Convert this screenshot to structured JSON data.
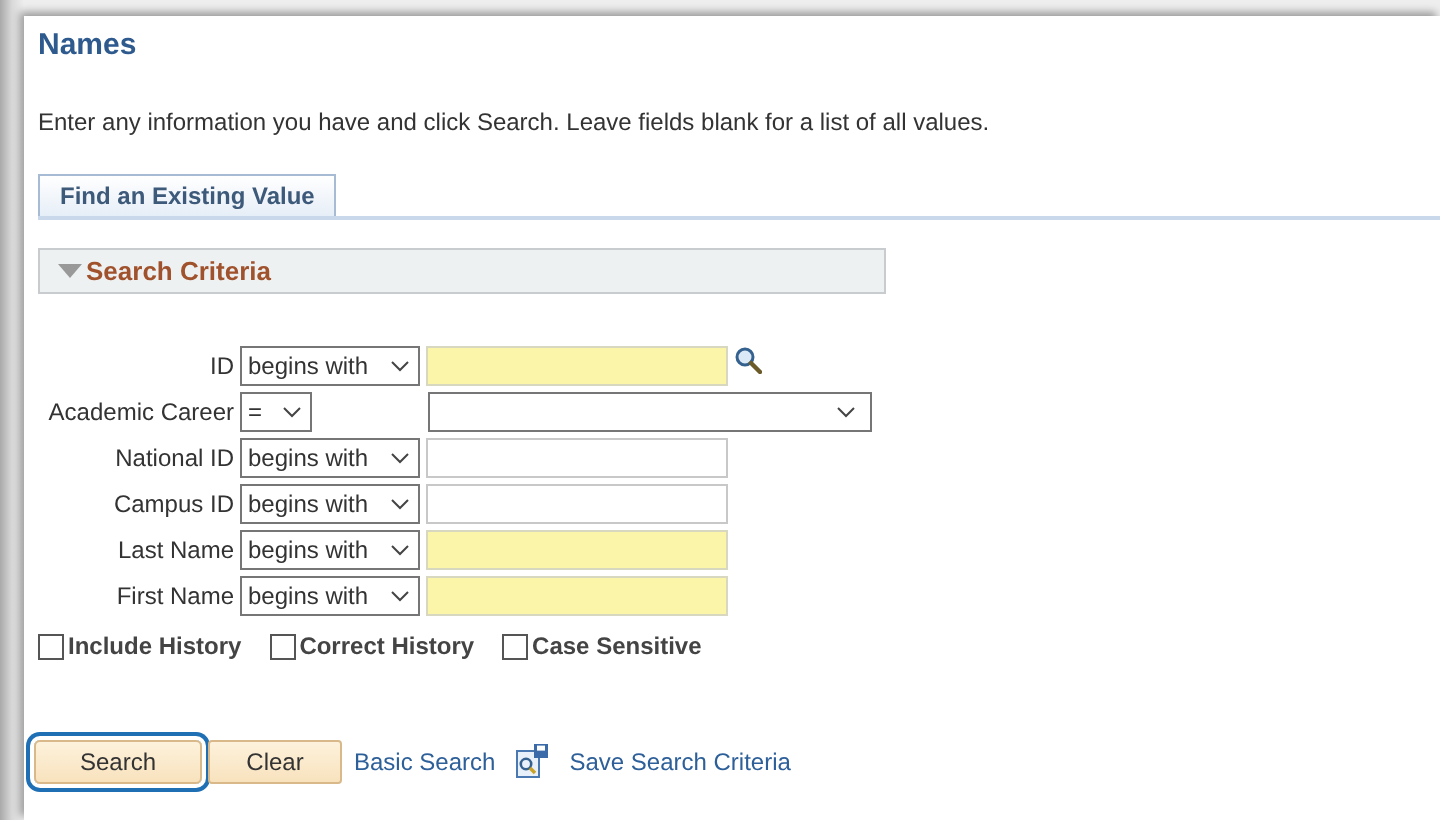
{
  "page": {
    "title": "Names",
    "instructions": "Enter any information you have and click Search. Leave fields blank for a list of all values."
  },
  "tabs": [
    {
      "label": "Find an Existing Value",
      "selected": true
    }
  ],
  "section": {
    "title": "Search Criteria",
    "expanded": true
  },
  "criteria": [
    {
      "label": "ID",
      "operator": "begins with",
      "kind": "text",
      "required": true,
      "lookup": true
    },
    {
      "label": "Academic Career",
      "operator": "=",
      "kind": "dropdown",
      "required": false,
      "lookup": false
    },
    {
      "label": "National ID",
      "operator": "begins with",
      "kind": "text",
      "required": false,
      "lookup": false
    },
    {
      "label": "Campus ID",
      "operator": "begins with",
      "kind": "text",
      "required": false,
      "lookup": false
    },
    {
      "label": "Last Name",
      "operator": "begins with",
      "kind": "text",
      "required": true,
      "lookup": false
    },
    {
      "label": "First Name",
      "operator": "begins with",
      "kind": "text",
      "required": true,
      "lookup": false
    }
  ],
  "options": [
    {
      "label": "Include History",
      "checked": false
    },
    {
      "label": "Correct History",
      "checked": false
    },
    {
      "label": "Case Sensitive",
      "checked": false
    }
  ],
  "actions": [
    {
      "kind": "button",
      "label": "Search",
      "highlighted": true
    },
    {
      "kind": "button",
      "label": "Clear",
      "highlighted": false
    },
    {
      "kind": "link",
      "label": "Basic Search"
    },
    {
      "kind": "save-link",
      "label": "Save Search Criteria"
    }
  ]
}
